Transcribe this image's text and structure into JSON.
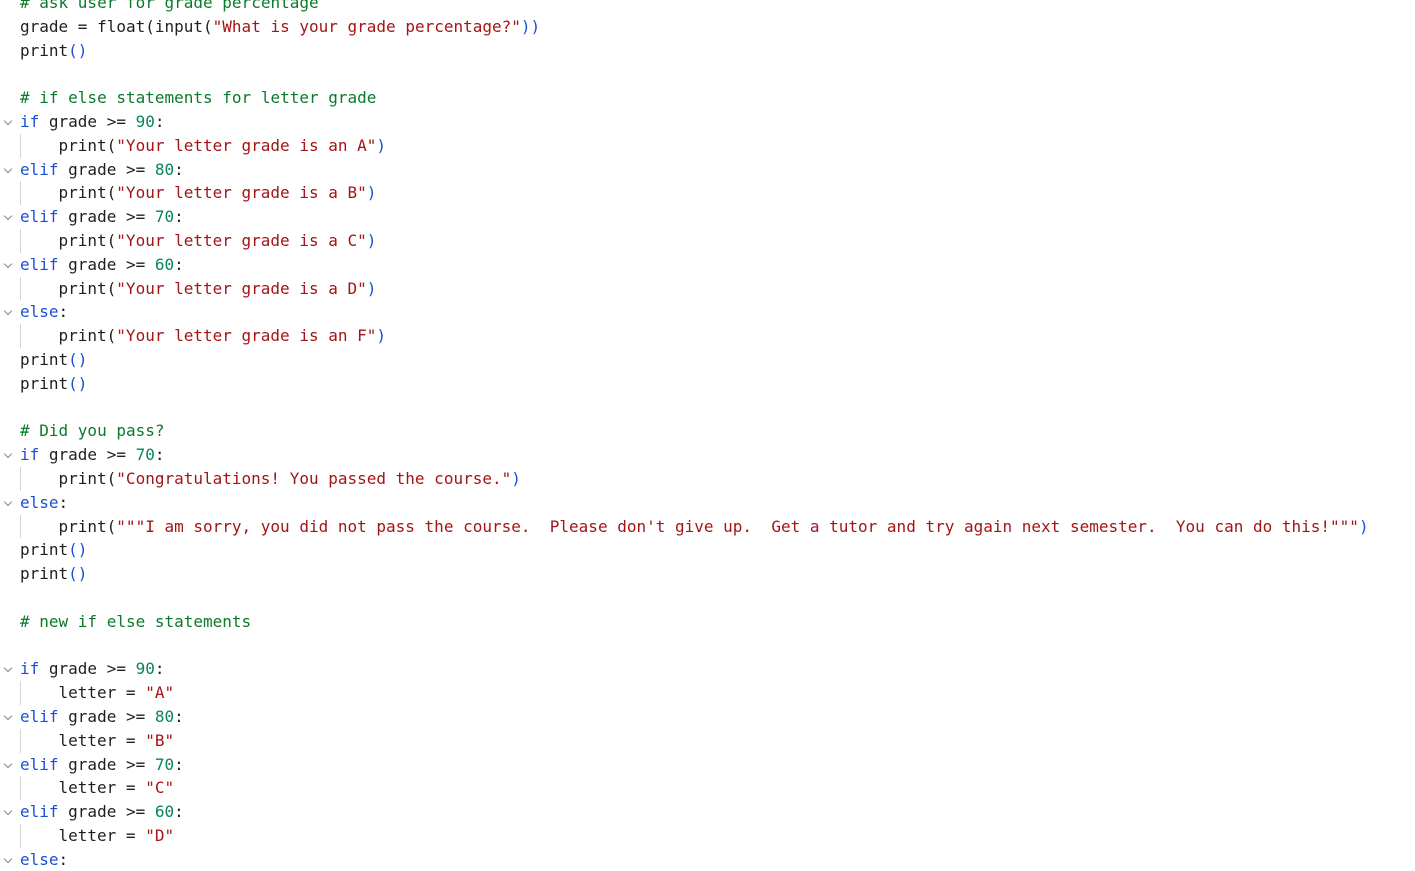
{
  "editor": {
    "language": "python",
    "lines": [
      [
        [
          "cmt",
          "# ask user for grade percentage"
        ]
      ],
      [
        [
          "t",
          "grade = float(input("
        ],
        [
          "str",
          "\"What is your grade percentage?\""
        ],
        [
          "pr",
          "))"
        ]
      ],
      [
        [
          "t",
          "print"
        ],
        [
          "pr",
          "()"
        ]
      ],
      [],
      [
        [
          "cmt",
          "# if else statements for letter grade"
        ]
      ],
      [
        [
          "kw",
          "if"
        ],
        [
          "t",
          " grade >= "
        ],
        [
          "num",
          "90"
        ],
        [
          "t",
          ":"
        ]
      ],
      [
        [
          "t",
          "print("
        ],
        [
          "str",
          "\"Your letter grade is an A\""
        ],
        [
          "pr",
          ")"
        ]
      ],
      [
        [
          "kw",
          "elif"
        ],
        [
          "t",
          " grade >= "
        ],
        [
          "num",
          "80"
        ],
        [
          "t",
          ":"
        ]
      ],
      [
        [
          "t",
          "print("
        ],
        [
          "str",
          "\"Your letter grade is a B\""
        ],
        [
          "pr",
          ")"
        ]
      ],
      [
        [
          "kw",
          "elif"
        ],
        [
          "t",
          " grade >= "
        ],
        [
          "num",
          "70"
        ],
        [
          "t",
          ":"
        ]
      ],
      [
        [
          "t",
          "print("
        ],
        [
          "str",
          "\"Your letter grade is a C\""
        ],
        [
          "pr",
          ")"
        ]
      ],
      [
        [
          "kw",
          "elif"
        ],
        [
          "t",
          " grade >= "
        ],
        [
          "num",
          "60"
        ],
        [
          "t",
          ":"
        ]
      ],
      [
        [
          "t",
          "print("
        ],
        [
          "str",
          "\"Your letter grade is a D\""
        ],
        [
          "pr",
          ")"
        ]
      ],
      [
        [
          "kw",
          "else"
        ],
        [
          "t",
          ":"
        ]
      ],
      [
        [
          "t",
          "print("
        ],
        [
          "str",
          "\"Your letter grade is an F\""
        ],
        [
          "pr",
          ")"
        ]
      ],
      [
        [
          "t",
          "print"
        ],
        [
          "pr",
          "()"
        ]
      ],
      [
        [
          "t",
          "print"
        ],
        [
          "pr",
          "()"
        ]
      ],
      [],
      [
        [
          "cmt",
          "# Did you pass?"
        ]
      ],
      [
        [
          "kw",
          "if"
        ],
        [
          "t",
          " grade >= "
        ],
        [
          "num",
          "70"
        ],
        [
          "t",
          ":"
        ]
      ],
      [
        [
          "t",
          "print("
        ],
        [
          "str",
          "\"Congratulations! You passed the course.\""
        ],
        [
          "pr",
          ")"
        ]
      ],
      [
        [
          "kw",
          "else"
        ],
        [
          "t",
          ":"
        ]
      ],
      [
        [
          "t",
          "print("
        ],
        [
          "str",
          "\"\"\"I am sorry, you did not pass the course.  Please don't give up.  Get a tutor and try again next semester.  You can do this!\"\"\""
        ],
        [
          "pr",
          ")"
        ]
      ],
      [
        [
          "t",
          "print"
        ],
        [
          "pr",
          "()"
        ]
      ],
      [
        [
          "t",
          "print"
        ],
        [
          "pr",
          "()"
        ]
      ],
      [],
      [
        [
          "cmt",
          "# new if else statements"
        ]
      ],
      [],
      [
        [
          "kw",
          "if"
        ],
        [
          "t",
          " grade >= "
        ],
        [
          "num",
          "90"
        ],
        [
          "t",
          ":"
        ]
      ],
      [
        [
          "t",
          "letter = "
        ],
        [
          "str",
          "\"A\""
        ]
      ],
      [
        [
          "kw",
          "elif"
        ],
        [
          "t",
          " grade >= "
        ],
        [
          "num",
          "80"
        ],
        [
          "t",
          ":"
        ]
      ],
      [
        [
          "t",
          "letter = "
        ],
        [
          "str",
          "\"B\""
        ]
      ],
      [
        [
          "kw",
          "elif"
        ],
        [
          "t",
          " grade >= "
        ],
        [
          "num",
          "70"
        ],
        [
          "t",
          ":"
        ]
      ],
      [
        [
          "t",
          "letter = "
        ],
        [
          "str",
          "\"C\""
        ]
      ],
      [
        [
          "kw",
          "elif"
        ],
        [
          "t",
          " grade >= "
        ],
        [
          "num",
          "60"
        ],
        [
          "t",
          ":"
        ]
      ],
      [
        [
          "t",
          "letter = "
        ],
        [
          "str",
          "\"D\""
        ]
      ],
      [
        [
          "kw",
          "else"
        ],
        [
          "t",
          ":"
        ]
      ]
    ],
    "folds": [
      5,
      7,
      9,
      11,
      13,
      19,
      21,
      28,
      30,
      32,
      34,
      36
    ],
    "indented": [
      6,
      8,
      10,
      12,
      14,
      20,
      22,
      29,
      31,
      33,
      35
    ],
    "colors": {
      "comment": "#0b7a2b",
      "keyword": "#1a4fd6",
      "string": "#a31515",
      "number": "#098658",
      "text": "#1f1f1f",
      "fold_chevron": "#8a8a8a",
      "indent_guide": "#d4d4d4"
    },
    "icons": {
      "fold": "chevron-down-icon"
    }
  }
}
